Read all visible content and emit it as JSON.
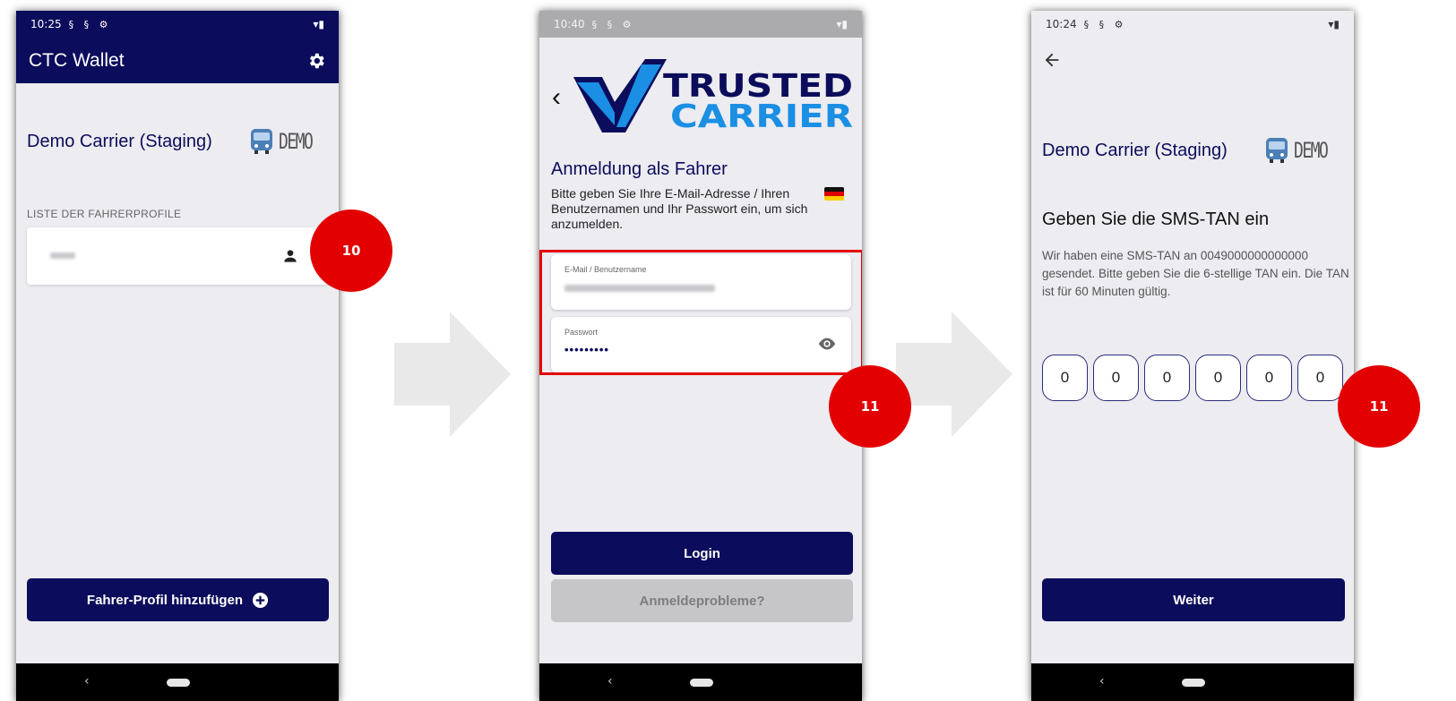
{
  "screen1": {
    "status_time": "10:25",
    "app_title": "CTC Wallet",
    "company_name": "Demo Carrier (Staging)",
    "logo_text": "DEMO",
    "section_label": "LISTE DER FAHRERPROFILE",
    "add_profile_button": "Fahrer-Profil hinzufügen",
    "step_badge": "10",
    "nav_back": "‹"
  },
  "screen2": {
    "status_time": "10:40",
    "back": "‹",
    "logo_line1": "TRUSTED",
    "logo_line2": "CARRIER",
    "heading": "Anmeldung als Fahrer",
    "description": "Bitte geben Sie Ihre E-Mail-Adresse / Ihren Benutzernamen und Ihr Passwort ein, um sich anzumelden.",
    "email_label": "E-Mail / Benutzername",
    "password_label": "Passwort",
    "password_value": "•••••••••",
    "login_button": "Login",
    "problems_button": "Anmeldeprobleme?",
    "step_badge": "11",
    "nav_back": "‹"
  },
  "screen3": {
    "status_time": "10:24",
    "company_name": "Demo Carrier (Staging)",
    "logo_text": "DEMO",
    "heading": "Geben Sie die SMS-TAN ein",
    "description": "Wir haben eine SMS-TAN an 0049000000000000 gesendet. Bitte geben Sie die 6-stellige TAN ein. Die TAN ist für 60 Minuten gültig.",
    "tan_digits": [
      "0",
      "0",
      "0",
      "0",
      "0",
      "0"
    ],
    "next_button": "Weiter",
    "step_badge": "11",
    "nav_back": "‹"
  },
  "colors": {
    "primary": "#0c0c5c",
    "badge_red": "#e30000",
    "logo_blue": "#1a8fe3",
    "logo_navy": "#0c0c5c"
  }
}
